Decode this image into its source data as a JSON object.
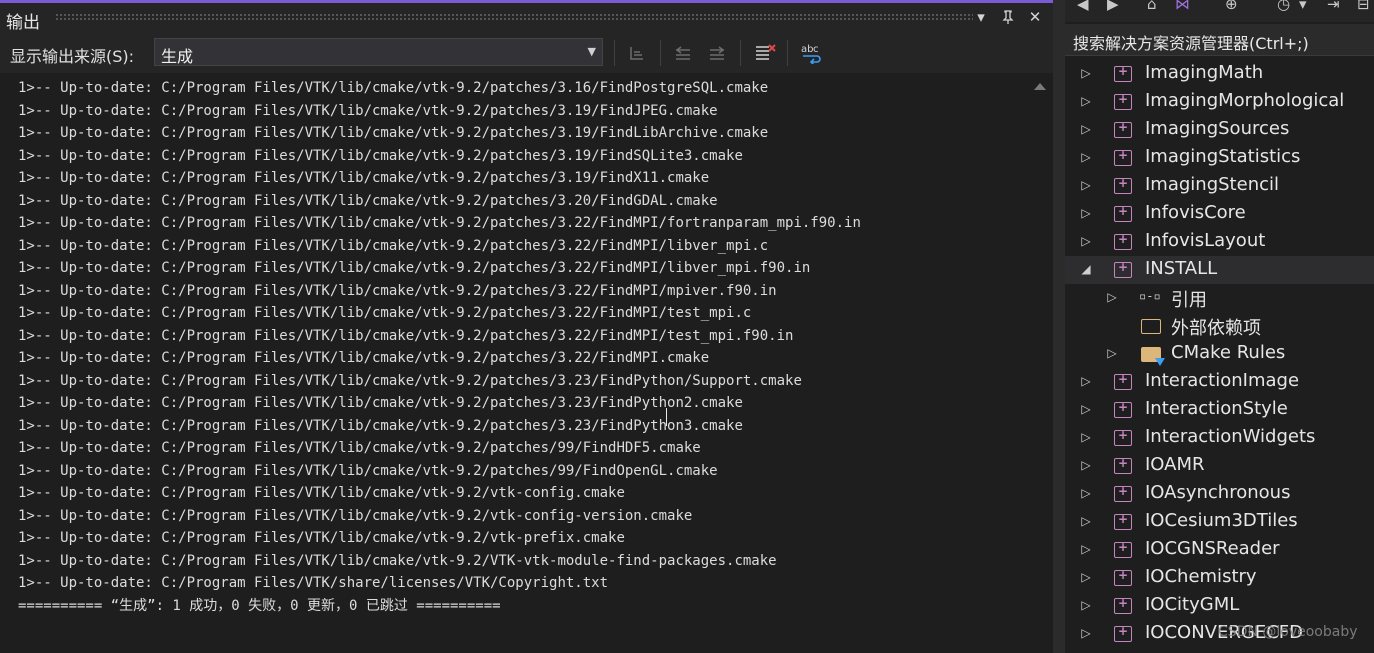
{
  "output": {
    "title": "输出",
    "source_label": "显示输出来源(S):",
    "source_value": "生成",
    "log_lines": [
      "1>-- Up-to-date: C:/Program Files/VTK/lib/cmake/vtk-9.2/patches/3.16/FindPostgreSQL.cmake",
      "1>-- Up-to-date: C:/Program Files/VTK/lib/cmake/vtk-9.2/patches/3.19/FindJPEG.cmake",
      "1>-- Up-to-date: C:/Program Files/VTK/lib/cmake/vtk-9.2/patches/3.19/FindLibArchive.cmake",
      "1>-- Up-to-date: C:/Program Files/VTK/lib/cmake/vtk-9.2/patches/3.19/FindSQLite3.cmake",
      "1>-- Up-to-date: C:/Program Files/VTK/lib/cmake/vtk-9.2/patches/3.19/FindX11.cmake",
      "1>-- Up-to-date: C:/Program Files/VTK/lib/cmake/vtk-9.2/patches/3.20/FindGDAL.cmake",
      "1>-- Up-to-date: C:/Program Files/VTK/lib/cmake/vtk-9.2/patches/3.22/FindMPI/fortranparam_mpi.f90.in",
      "1>-- Up-to-date: C:/Program Files/VTK/lib/cmake/vtk-9.2/patches/3.22/FindMPI/libver_mpi.c",
      "1>-- Up-to-date: C:/Program Files/VTK/lib/cmake/vtk-9.2/patches/3.22/FindMPI/libver_mpi.f90.in",
      "1>-- Up-to-date: C:/Program Files/VTK/lib/cmake/vtk-9.2/patches/3.22/FindMPI/mpiver.f90.in",
      "1>-- Up-to-date: C:/Program Files/VTK/lib/cmake/vtk-9.2/patches/3.22/FindMPI/test_mpi.c",
      "1>-- Up-to-date: C:/Program Files/VTK/lib/cmake/vtk-9.2/patches/3.22/FindMPI/test_mpi.f90.in",
      "1>-- Up-to-date: C:/Program Files/VTK/lib/cmake/vtk-9.2/patches/3.22/FindMPI.cmake",
      "1>-- Up-to-date: C:/Program Files/VTK/lib/cmake/vtk-9.2/patches/3.23/FindPython/Support.cmake",
      "1>-- Up-to-date: C:/Program Files/VTK/lib/cmake/vtk-9.2/patches/3.23/FindPython2.cmake",
      "1>-- Up-to-date: C:/Program Files/VTK/lib/cmake/vtk-9.2/patches/3.23/FindPython3.cmake",
      "1>-- Up-to-date: C:/Program Files/VTK/lib/cmake/vtk-9.2/patches/99/FindHDF5.cmake",
      "1>-- Up-to-date: C:/Program Files/VTK/lib/cmake/vtk-9.2/patches/99/FindOpenGL.cmake",
      "1>-- Up-to-date: C:/Program Files/VTK/lib/cmake/vtk-9.2/vtk-config.cmake",
      "1>-- Up-to-date: C:/Program Files/VTK/lib/cmake/vtk-9.2/vtk-config-version.cmake",
      "1>-- Up-to-date: C:/Program Files/VTK/lib/cmake/vtk-9.2/vtk-prefix.cmake",
      "1>-- Up-to-date: C:/Program Files/VTK/lib/cmake/vtk-9.2/VTK-vtk-module-find-packages.cmake",
      "1>-- Up-to-date: C:/Program Files/VTK/share/licenses/VTK/Copyright.txt",
      "========== “生成”: 1 成功，0 失败，0 更新，0 已跳过 =========="
    ]
  },
  "toolbar_icons": {
    "dropdown": "chevron-down-icon",
    "pin": "pin-icon",
    "close": "close-icon",
    "find_message": "find-message-icon",
    "prev_message": "previous-message-icon",
    "next_message": "next-message-icon",
    "clear_all": "clear-all-icon",
    "word_wrap": "word-wrap-icon"
  },
  "solution_explorer": {
    "search_placeholder": "搜索解决方案资源管理器(Ctrl+;)",
    "items": [
      {
        "label": "ImagingMath",
        "kind": "project",
        "level": 0,
        "expanded": false
      },
      {
        "label": "ImagingMorphological",
        "kind": "project",
        "level": 0,
        "expanded": false
      },
      {
        "label": "ImagingSources",
        "kind": "project",
        "level": 0,
        "expanded": false
      },
      {
        "label": "ImagingStatistics",
        "kind": "project",
        "level": 0,
        "expanded": false
      },
      {
        "label": "ImagingStencil",
        "kind": "project",
        "level": 0,
        "expanded": false
      },
      {
        "label": "InfovisCore",
        "kind": "project",
        "level": 0,
        "expanded": false
      },
      {
        "label": "InfovisLayout",
        "kind": "project",
        "level": 0,
        "expanded": false
      },
      {
        "label": "INSTALL",
        "kind": "project",
        "level": 0,
        "expanded": true,
        "selected": true
      },
      {
        "label": "引用",
        "kind": "references",
        "level": 1,
        "expanded": false
      },
      {
        "label": "外部依赖项",
        "kind": "dependencies",
        "level": 1,
        "leaf": true
      },
      {
        "label": "CMake Rules",
        "kind": "filter-folder",
        "level": 1,
        "expanded": false
      },
      {
        "label": "InteractionImage",
        "kind": "project",
        "level": 0,
        "expanded": false
      },
      {
        "label": "InteractionStyle",
        "kind": "project",
        "level": 0,
        "expanded": false
      },
      {
        "label": "InteractionWidgets",
        "kind": "project",
        "level": 0,
        "expanded": false
      },
      {
        "label": "IOAMR",
        "kind": "project",
        "level": 0,
        "expanded": false
      },
      {
        "label": "IOAsynchronous",
        "kind": "project",
        "level": 0,
        "expanded": false
      },
      {
        "label": "IOCesium3DTiles",
        "kind": "project",
        "level": 0,
        "expanded": false
      },
      {
        "label": "IOCGNSReader",
        "kind": "project",
        "level": 0,
        "expanded": false
      },
      {
        "label": "IOChemistry",
        "kind": "project",
        "level": 0,
        "expanded": false
      },
      {
        "label": "IOCityGML",
        "kind": "project",
        "level": 0,
        "expanded": false
      },
      {
        "label": "IOCONVERGECFD",
        "kind": "project",
        "level": 0,
        "expanded": false
      }
    ]
  },
  "watermark": "CSDN @loveoobaby",
  "colors": {
    "accent": "#7c5cd6",
    "project_icon": "#c586c0",
    "folder": "#dcb67a"
  }
}
